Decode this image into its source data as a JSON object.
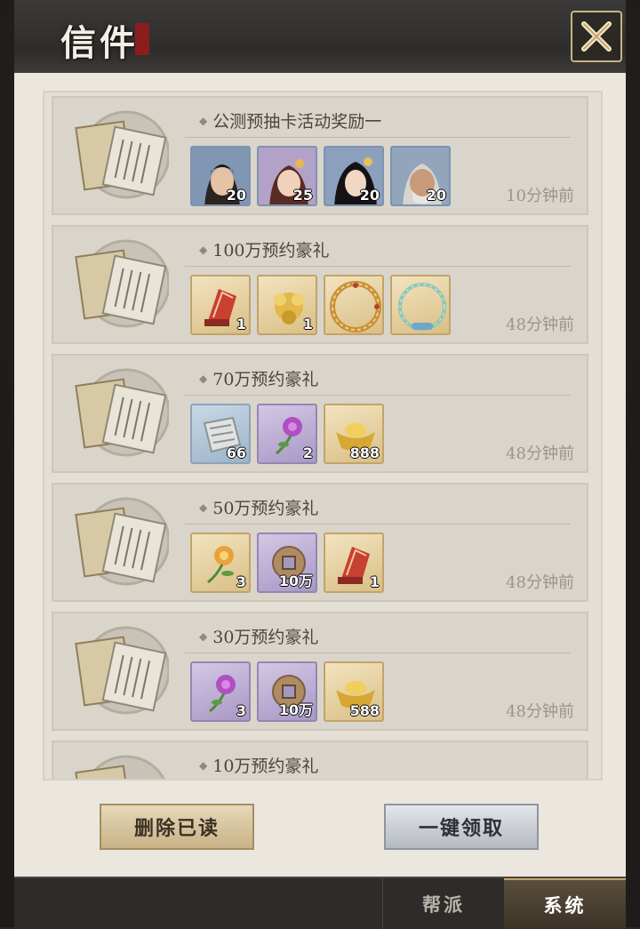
{
  "header": {
    "title": "信件"
  },
  "mails": [
    {
      "title": "公测预抽卡活动奖励一",
      "time": "10分钟前",
      "rewards": [
        {
          "kind": "hero",
          "icon": "hero-portrait-swordsman",
          "qty": "20"
        },
        {
          "kind": "hero",
          "icon": "hero-portrait-young-woman",
          "qty": "25"
        },
        {
          "kind": "hero",
          "icon": "hero-portrait-lady",
          "qty": "20"
        },
        {
          "kind": "hero",
          "icon": "hero-portrait-old-man",
          "qty": "20"
        }
      ]
    },
    {
      "title": "100万预约豪礼",
      "time": "48分钟前",
      "rewards": [
        {
          "kind": "gold",
          "icon": "red-fan-scroll-icon",
          "qty": "1"
        },
        {
          "kind": "gold",
          "icon": "gold-treasure-icon",
          "qty": "1"
        },
        {
          "kind": "gold",
          "icon": "gold-ring-frame-icon",
          "qty": ""
        },
        {
          "kind": "gold",
          "icon": "jade-ring-frame-icon",
          "qty": ""
        }
      ]
    },
    {
      "title": "70万预约豪礼",
      "time": "48分钟前",
      "rewards": [
        {
          "kind": "blue",
          "icon": "scroll-map-icon",
          "qty": "66"
        },
        {
          "kind": "purple",
          "icon": "purple-rose-icon",
          "qty": "2"
        },
        {
          "kind": "gold",
          "icon": "gold-ingot-icon",
          "qty": "888"
        }
      ]
    },
    {
      "title": "50万预约豪礼",
      "time": "48分钟前",
      "rewards": [
        {
          "kind": "gold",
          "icon": "yellow-rose-icon",
          "qty": "3"
        },
        {
          "kind": "purple",
          "icon": "copper-coin-icon",
          "qty": "10万"
        },
        {
          "kind": "gold",
          "icon": "red-fan-scroll-icon",
          "qty": "1"
        }
      ]
    },
    {
      "title": "30万预约豪礼",
      "time": "48分钟前",
      "rewards": [
        {
          "kind": "purple",
          "icon": "purple-rose-icon",
          "qty": "3"
        },
        {
          "kind": "purple",
          "icon": "copper-coin-icon",
          "qty": "10万"
        },
        {
          "kind": "gold",
          "icon": "gold-ingot-icon",
          "qty": "588"
        }
      ]
    },
    {
      "title": "10万预约豪礼",
      "time": "",
      "rewards": []
    }
  ],
  "buttons": {
    "delete_read": "删除已读",
    "claim_all": "一键领取"
  },
  "tabs": {
    "guild": "帮派",
    "system": "系统",
    "active": "system"
  }
}
